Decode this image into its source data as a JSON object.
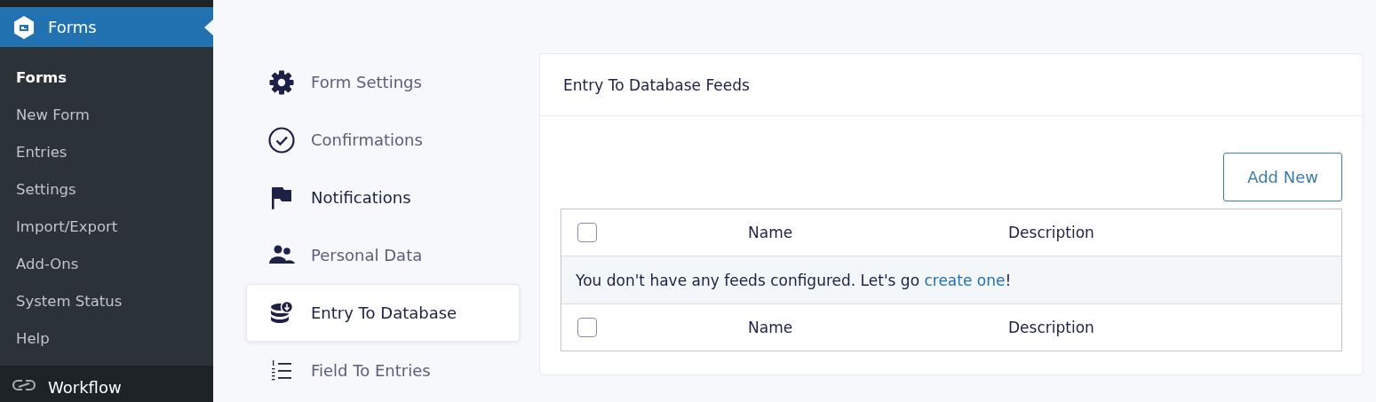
{
  "admin_menu": {
    "header": {
      "label": "Forms",
      "current": true
    },
    "items": [
      {
        "label": "Forms",
        "selected": true
      },
      {
        "label": "New Form",
        "selected": false
      },
      {
        "label": "Entries",
        "selected": false
      },
      {
        "label": "Settings",
        "selected": false
      },
      {
        "label": "Import/Export",
        "selected": false
      },
      {
        "label": "Add-Ons",
        "selected": false
      },
      {
        "label": "System Status",
        "selected": false
      },
      {
        "label": "Help",
        "selected": false
      }
    ],
    "next_menu": {
      "label": "Workflow"
    }
  },
  "settings_nav": [
    {
      "label": "Form Settings",
      "kind": "gear",
      "selected": false,
      "hovered": false
    },
    {
      "label": "Confirmations",
      "kind": "check",
      "selected": false,
      "hovered": false
    },
    {
      "label": "Notifications",
      "kind": "flag",
      "selected": false,
      "hovered": true
    },
    {
      "label": "Personal Data",
      "kind": "users",
      "selected": false,
      "hovered": false
    },
    {
      "label": "Entry To Database",
      "kind": "database",
      "selected": true,
      "hovered": false
    },
    {
      "label": "Field To Entries",
      "kind": "list",
      "selected": false,
      "hovered": false
    }
  ],
  "panel": {
    "title": "Entry To Database Feeds",
    "add_button": "Add New",
    "table": {
      "columns": [
        "Name",
        "Description"
      ],
      "header_checked": false,
      "empty_message": {
        "text": "You don't have any feeds configured. Let's go ",
        "link": "create one",
        "suffix": "!"
      },
      "footer_columns": [
        "Name",
        "Description"
      ],
      "footer_checked": false
    }
  }
}
